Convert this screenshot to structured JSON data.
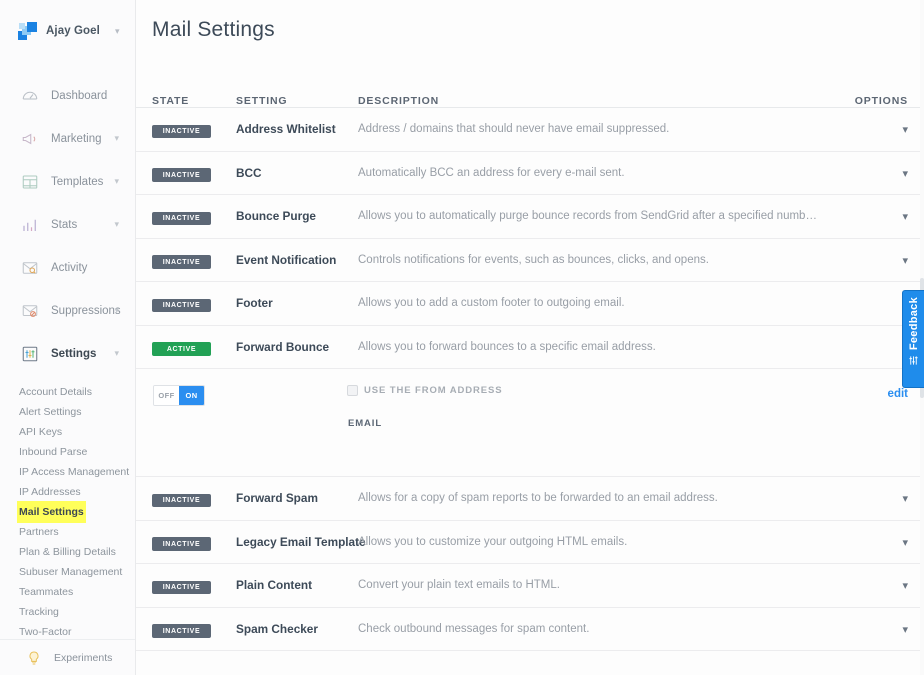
{
  "sidebar": {
    "brand": {
      "name": "Ajay Goel",
      "caret": "chevron-down-icon"
    },
    "nav": [
      {
        "label": "Dashboard",
        "icon": "gauge-icon",
        "caret": false,
        "active": false
      },
      {
        "label": "Marketing",
        "icon": "megaphone-icon",
        "caret": true,
        "active": false
      },
      {
        "label": "Templates",
        "icon": "templates-icon",
        "caret": true,
        "active": false
      },
      {
        "label": "Stats",
        "icon": "bar-chart-icon",
        "caret": true,
        "active": false
      },
      {
        "label": "Activity",
        "icon": "envelope-search-icon",
        "caret": false,
        "active": false
      },
      {
        "label": "Suppressions",
        "icon": "envelope-block-icon",
        "caret": true,
        "active": false
      },
      {
        "label": "Settings",
        "icon": "sliders-icon",
        "caret": true,
        "active": true
      }
    ],
    "sub_items": [
      {
        "label": "Account Details",
        "highlight": false
      },
      {
        "label": "Alert Settings",
        "highlight": false
      },
      {
        "label": "API Keys",
        "highlight": false
      },
      {
        "label": "Inbound Parse",
        "highlight": false
      },
      {
        "label": "IP Access Management",
        "highlight": false
      },
      {
        "label": "IP Addresses",
        "highlight": false
      },
      {
        "label": "Mail Settings",
        "highlight": true
      },
      {
        "label": "Partners",
        "highlight": false
      },
      {
        "label": "Plan & Billing Details",
        "highlight": false
      },
      {
        "label": "Subuser Management",
        "highlight": false
      },
      {
        "label": "Teammates",
        "highlight": false
      },
      {
        "label": "Tracking",
        "highlight": false
      },
      {
        "label": "Two-Factor Authentication",
        "highlight": false
      }
    ],
    "footer": {
      "label": "Experiments",
      "icon": "lightbulb-icon"
    }
  },
  "main": {
    "title": "Mail Settings",
    "columns": {
      "state": "STATE",
      "setting": "SETTING",
      "description": "DESCRIPTION",
      "options": "OPTIONS"
    },
    "rows": [
      {
        "state": "INACTIVE",
        "name": "Address Whitelist",
        "description": "Address / domains that should never have email suppressed.",
        "expanded": false
      },
      {
        "state": "INACTIVE",
        "name": "BCC",
        "description": "Automatically BCC an address for every e-mail sent.",
        "expanded": false
      },
      {
        "state": "INACTIVE",
        "name": "Bounce Purge",
        "description": "Allows you to automatically purge bounce records from SendGrid after a specified number of days.",
        "expanded": false
      },
      {
        "state": "INACTIVE",
        "name": "Event Notification",
        "description": "Controls notifications for events, such as bounces, clicks, and opens.",
        "expanded": false
      },
      {
        "state": "INACTIVE",
        "name": "Footer",
        "description": "Allows you to add a custom footer to outgoing email.",
        "expanded": false
      },
      {
        "state": "ACTIVE",
        "name": "Forward Bounce",
        "description": "Allows you to forward bounces to a specific email address.",
        "expanded": true
      },
      {
        "state": "INACTIVE",
        "name": "Forward Spam",
        "description": "Allows for a copy of spam reports to be forwarded to an email address.",
        "expanded": false
      },
      {
        "state": "INACTIVE",
        "name": "Legacy Email Template",
        "description": "Allows you to customize your outgoing HTML emails.",
        "expanded": false
      },
      {
        "state": "INACTIVE",
        "name": "Plain Content",
        "description": "Convert your plain text emails to HTML.",
        "expanded": false
      },
      {
        "state": "INACTIVE",
        "name": "Spam Checker",
        "description": "Check outbound messages for spam content.",
        "expanded": false
      }
    ],
    "expanded_panel": {
      "toggle": {
        "off_label": "OFF",
        "on_label": "ON",
        "state": "ON"
      },
      "checkbox_label": "USE THE FROM ADDRESS",
      "email_label": "EMAIL",
      "edit_label": "edit"
    }
  },
  "feedback": {
    "label": "Feedback",
    "icon": "sliders-icon"
  },
  "colors": {
    "accent_blue": "#2b8ef0",
    "active_green": "#22a155",
    "inactive_gray": "#5c6775",
    "highlight_yellow": "#ffff5a"
  }
}
